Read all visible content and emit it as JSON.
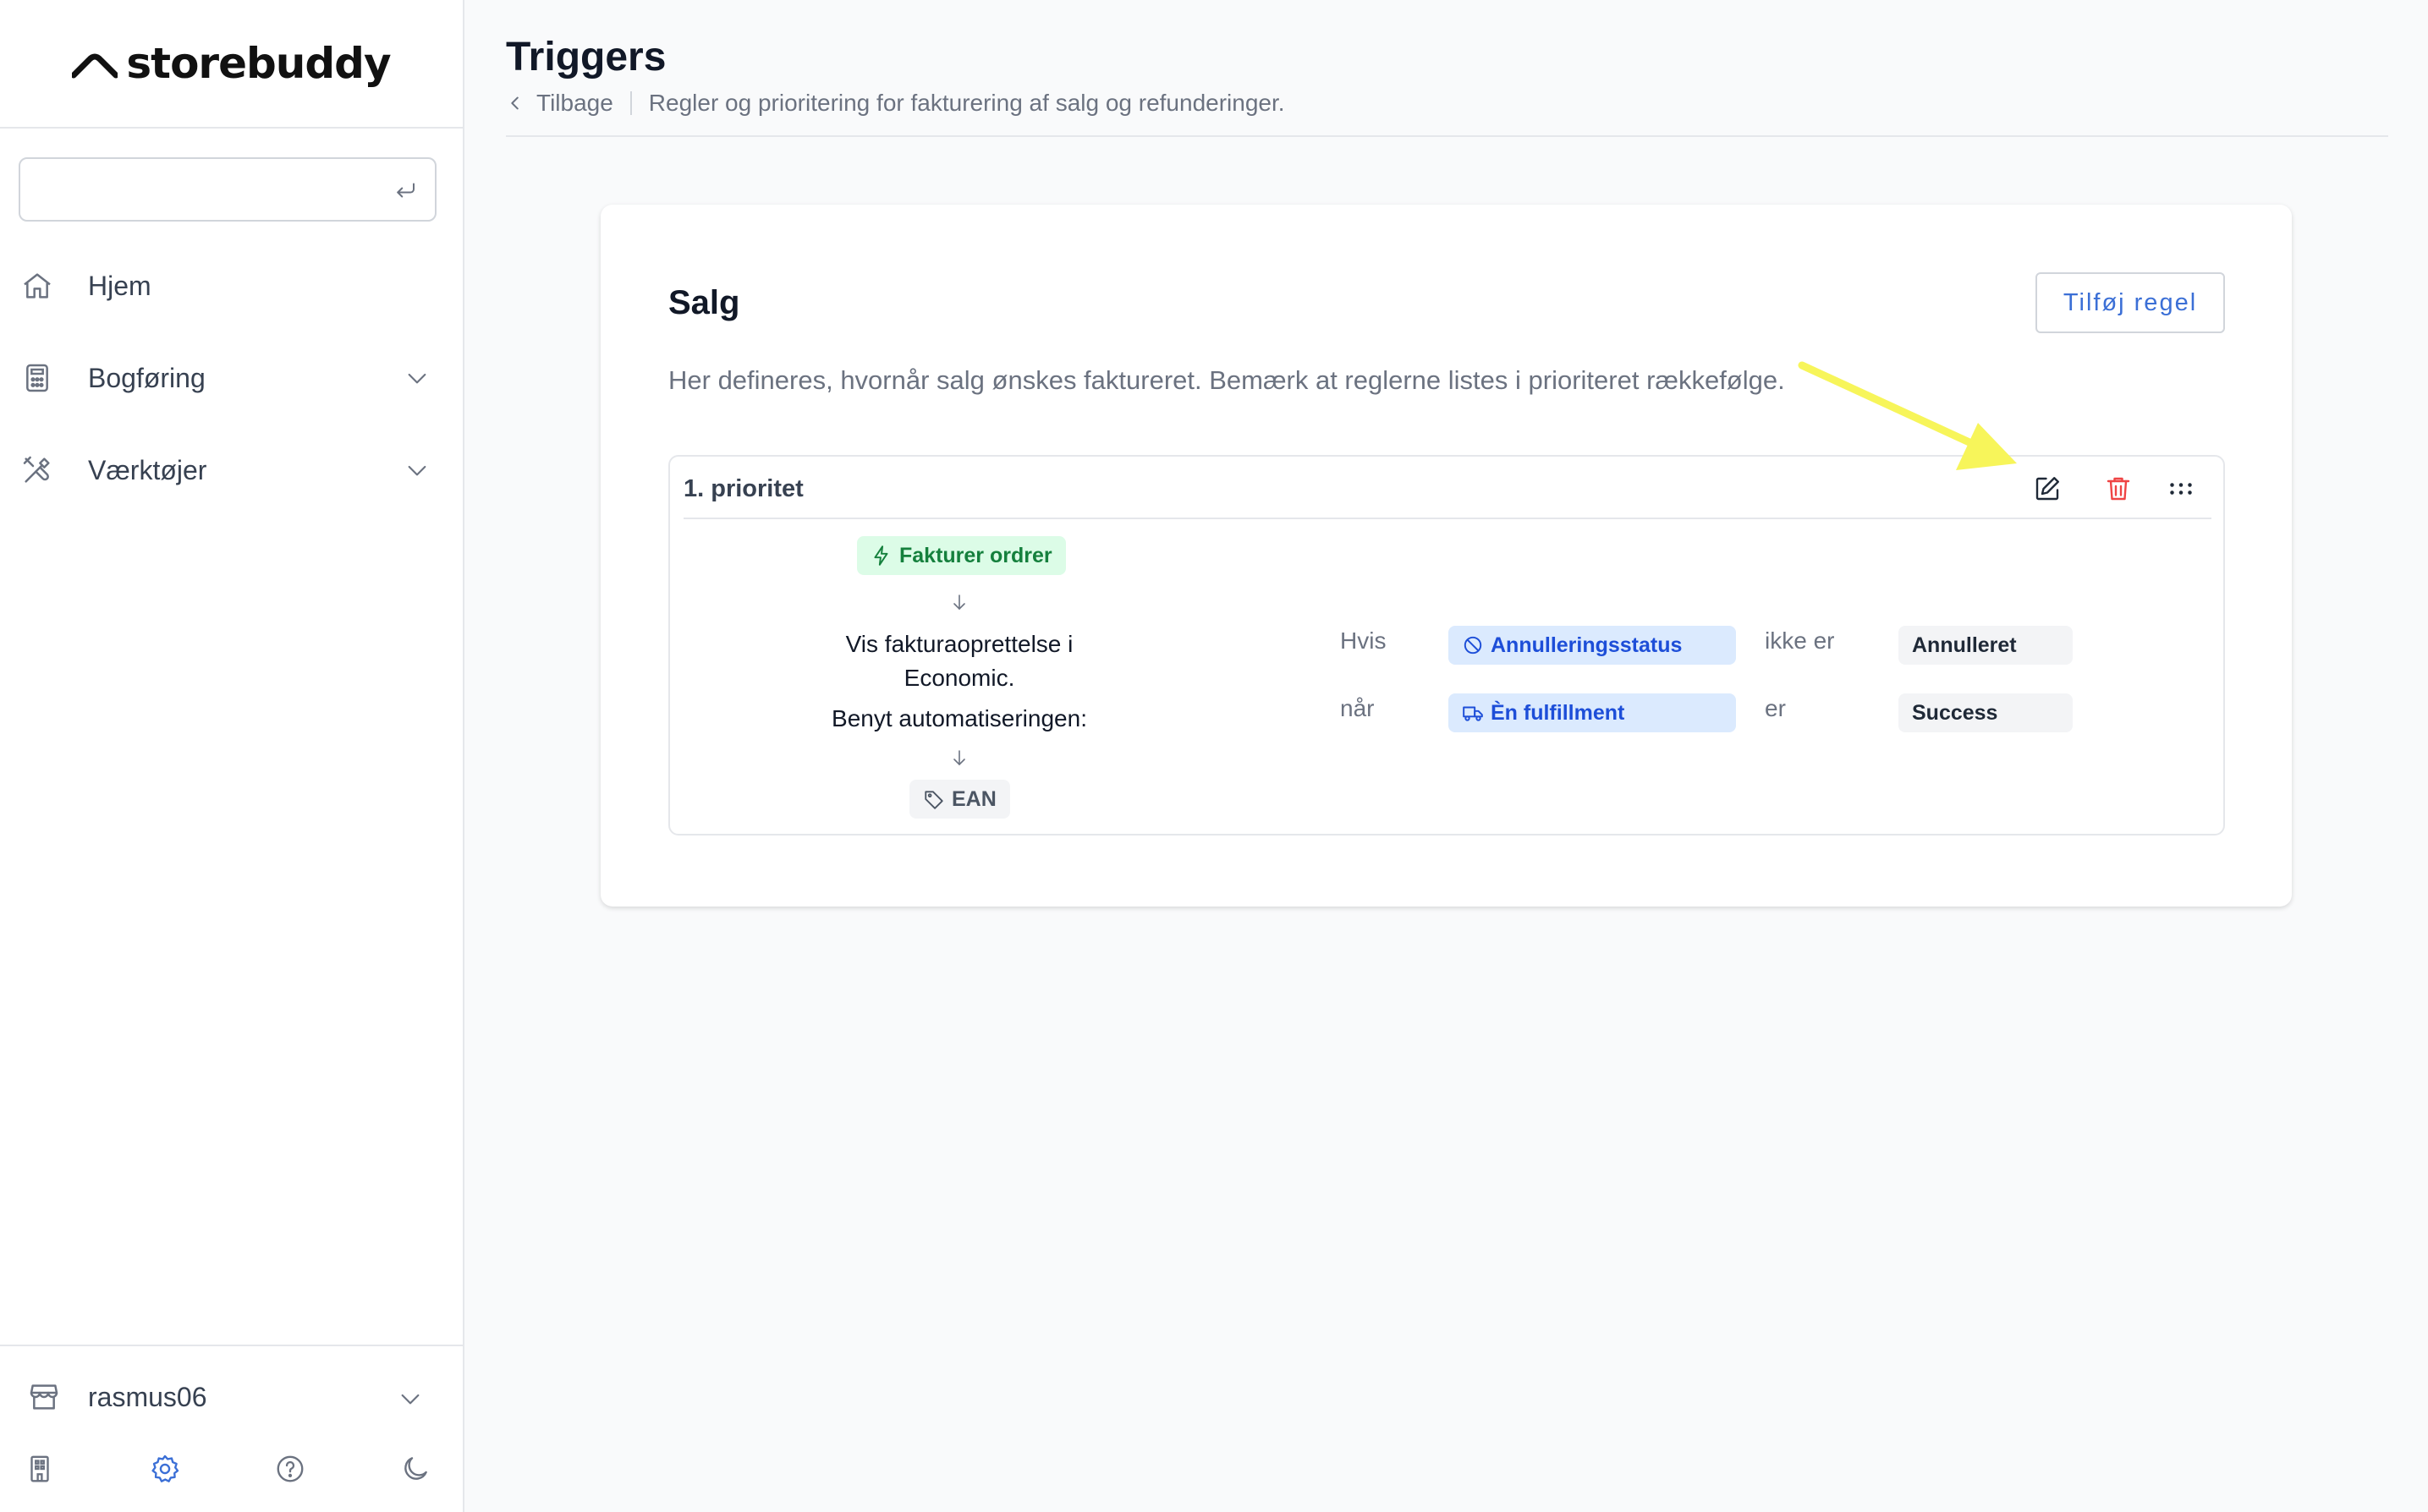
{
  "brand": {
    "name": "storebuddy"
  },
  "search": {
    "value": "",
    "placeholder": ""
  },
  "sidebar": {
    "items": [
      {
        "label": "Hjem"
      },
      {
        "label": "Bogføring"
      },
      {
        "label": "Værktøjer"
      }
    ],
    "account": {
      "label": "rasmus06"
    }
  },
  "page": {
    "title": "Triggers",
    "back_label": "Tilbage",
    "subtitle": "Regler og prioritering for fakturering af salg og refunderinger."
  },
  "card": {
    "title": "Salg",
    "add_button": "Tilføj regel",
    "description": "Her defineres, hvornår salg ønskes faktureret. Bemærk at reglerne listes i prioriteret rækkefølge."
  },
  "rule": {
    "title": "1. prioritet",
    "trigger": "Fakturer ordrer",
    "action_line1": "Vis fakturaoprettelse i",
    "action_line2": "Economic.",
    "automation_label": "Benyt automatiseringen:",
    "automation": "EAN",
    "conditions": [
      {
        "connector": "Hvis",
        "field": "Annulleringsstatus",
        "operator": "ikke er",
        "value": "Annulleret"
      },
      {
        "connector": "når",
        "field": "Èn fulfillment",
        "operator": "er",
        "value": "Success"
      }
    ]
  },
  "colors": {
    "accent": "#3b6fd6",
    "delete": "#ef4444",
    "annotation_arrow": "#f7f55a"
  }
}
